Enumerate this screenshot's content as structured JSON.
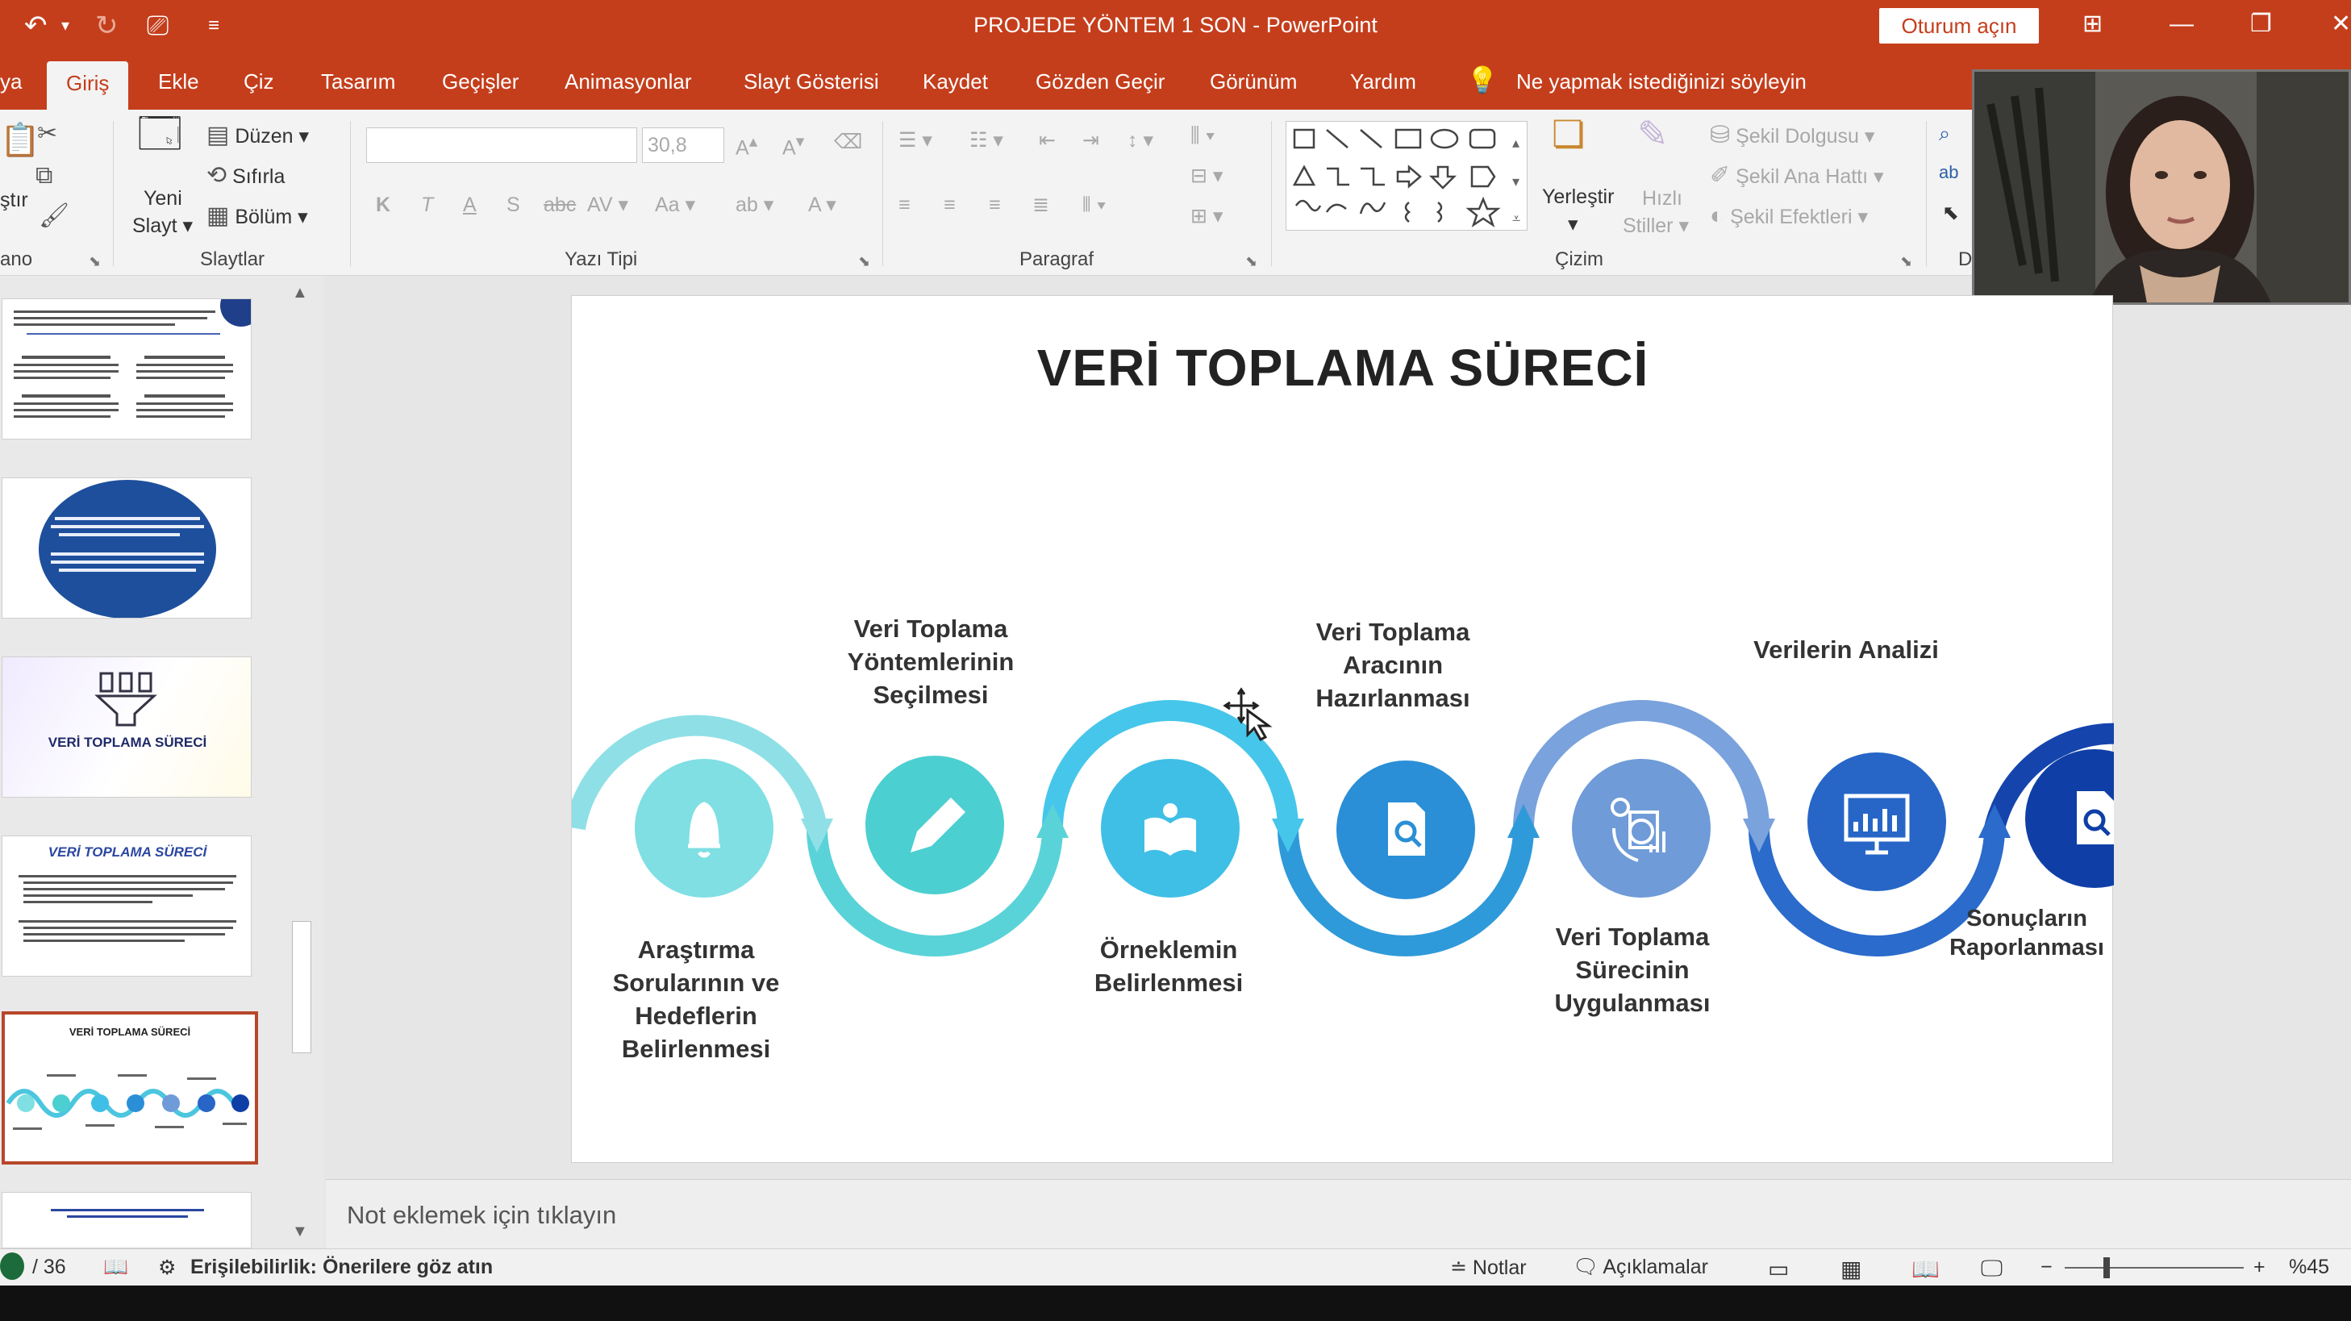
{
  "app": {
    "doc_title": "PROJEDE YÖNTEM 1 SON",
    "app_name": "PowerPoint",
    "title_separator": "-",
    "signin_label": "Oturum açın"
  },
  "tabs": [
    {
      "label": "ya"
    },
    {
      "label": "Giriş",
      "active": true
    },
    {
      "label": "Ekle"
    },
    {
      "label": "Çiz"
    },
    {
      "label": "Tasarım"
    },
    {
      "label": "Geçişler"
    },
    {
      "label": "Animasyonlar"
    },
    {
      "label": "Slayt Gösterisi"
    },
    {
      "label": "Kaydet"
    },
    {
      "label": "Gözden Geçir"
    },
    {
      "label": "Görünüm"
    },
    {
      "label": "Yardım"
    }
  ],
  "tellme": "Ne yapmak istediğinizi söyleyin",
  "ribbon": {
    "clipboard": {
      "paste_fragment": "ştır",
      "label": "ano"
    },
    "slides": {
      "new_slide": "Yeni",
      "new_slide2": "Slayt",
      "layout": "Düzen",
      "reset": "Sıfırla",
      "section": "Bölüm",
      "label": "Slaytlar"
    },
    "font": {
      "size": "30,8",
      "label": "Yazı Tipi",
      "bold": "K",
      "italic": "T",
      "underline": "A",
      "shadow": "S",
      "strike": "abc",
      "case": "Aa"
    },
    "paragraph": {
      "label": "Paragraf"
    },
    "drawing": {
      "arrange": "Yerleştir",
      "quick_styles": "Hızlı",
      "quick_styles2": "Stiller",
      "fill": "Şekil Dolgusu",
      "outline": "Şekil Ana Hattı",
      "effects": "Şekil Efektleri",
      "label": "Çizim"
    },
    "editing": {
      "label_fragment": "D"
    }
  },
  "thumbnails": [
    {
      "title": ""
    },
    {
      "title": ""
    },
    {
      "title": "VERİ TOPLAMA SÜRECİ"
    },
    {
      "title": "VERİ TOPLAMA SÜRECİ"
    },
    {
      "title": "VERİ TOPLAMA SÜRECİ",
      "selected": true
    },
    {
      "title": ""
    }
  ],
  "slide": {
    "title": "VERİ TOPLAMA SÜRECİ",
    "steps": [
      {
        "label": "Araştırma\nSorularının ve\nHedeflerin\nBelirlenmesi",
        "icon": "bell-icon",
        "color": "#7fdfe3"
      },
      {
        "label": "Veri Toplama\nYöntemlerinin\nSeçilmesi",
        "icon": "pencil-icon",
        "color": "#4ccfd0"
      },
      {
        "label": "Örneklemin\nBelirlenmesi",
        "icon": "book-icon",
        "color": "#3fbfe6"
      },
      {
        "label": "Veri Toplama\nAracının\nHazırlanması",
        "icon": "search-document-icon",
        "color": "#2a8fd6"
      },
      {
        "label": "Veri Toplama\nSürecinin\nUygulanması",
        "icon": "gears-chart-icon",
        "color": "#6f9bd8"
      },
      {
        "label": "Verilerin Analizi",
        "icon": "monitor-chart-icon",
        "color": "#2766c7"
      },
      {
        "label": "Sonuçların\nRaporlanması",
        "icon": "search-report-icon",
        "color": "#0f3fa6"
      }
    ]
  },
  "notes_placeholder": "Not eklemek için tıklayın",
  "status": {
    "slide_counter": "/ 36",
    "accessibility": "Erişilebilirlik: Önerilere göz atın",
    "notes": "Notlar",
    "comments": "Açıklamalar",
    "zoom": "%45"
  }
}
